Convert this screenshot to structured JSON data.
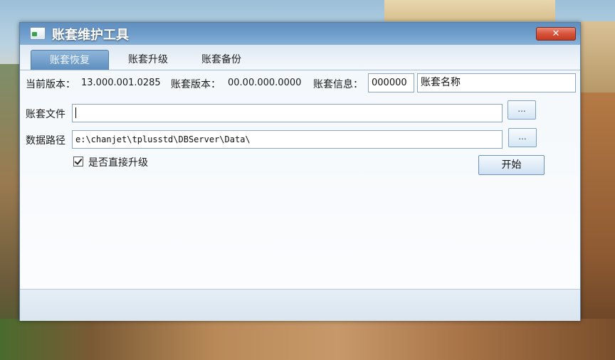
{
  "window": {
    "title": "账套维护工具",
    "close_label": "✕"
  },
  "tabs": [
    {
      "label": "账套恢复",
      "active": true
    },
    {
      "label": "账套升级",
      "active": false
    },
    {
      "label": "账套备份",
      "active": false
    }
  ],
  "info": {
    "current_version_label": "当前版本：",
    "current_version_value": "13.000.001.0285",
    "account_version_label": "账套版本：",
    "account_version_value": "00.00.000.0000",
    "account_info_label": "账套信息：",
    "account_code": "000000",
    "account_name": "账套名称"
  },
  "form": {
    "account_file_label": "账套文件",
    "account_file_value": "",
    "data_path_label": "数据路径",
    "data_path_value": "e:\\chanjet\\tplusstd\\DBServer\\Data\\",
    "browse_label": "...",
    "direct_upgrade_label": "是否直接升级",
    "direct_upgrade_checked": true,
    "start_label": "开始"
  },
  "colors": {
    "title_bar": "#6f9dcb",
    "close_button": "#d9533b",
    "active_tab": "#6f9ac6"
  }
}
